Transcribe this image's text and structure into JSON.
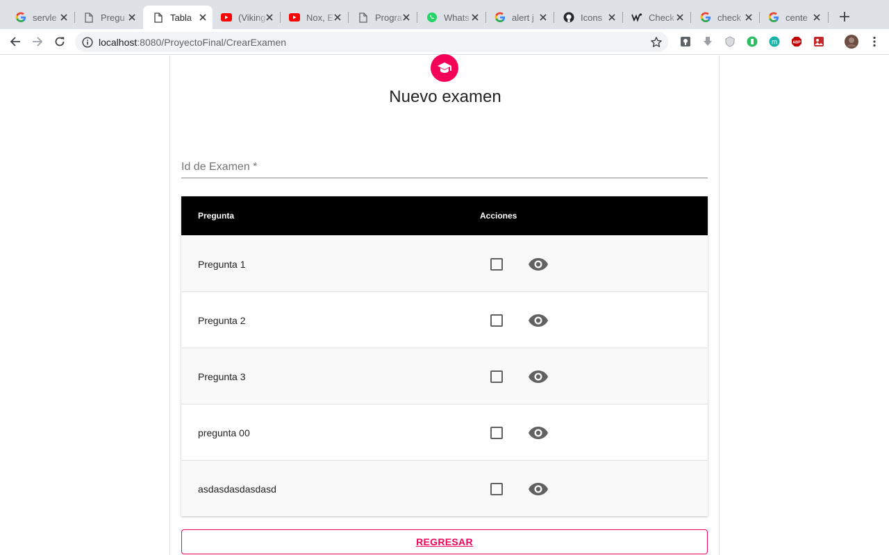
{
  "browser": {
    "tabs": [
      {
        "title": "servle",
        "icon": "google-icon"
      },
      {
        "title": "Pregu",
        "icon": "document-icon"
      },
      {
        "title": "Tabla",
        "icon": "document-icon",
        "active": true
      },
      {
        "title": "(Viking",
        "icon": "youtube-icon"
      },
      {
        "title": "Nox, E",
        "icon": "youtube-icon"
      },
      {
        "title": "Progra",
        "icon": "document-icon"
      },
      {
        "title": "Whats",
        "icon": "whatsapp-icon"
      },
      {
        "title": "alert j",
        "icon": "google-icon"
      },
      {
        "title": "Icons",
        "icon": "github-icon"
      },
      {
        "title": "Check",
        "icon": "site-icon"
      },
      {
        "title": "check",
        "icon": "google-icon"
      },
      {
        "title": "cente",
        "icon": "google-icon"
      }
    ],
    "url_host": "localhost",
    "url_path": ":8080/ProyectoFinal/CrearExamen"
  },
  "colors": {
    "accent": "#f50057",
    "header": "#000000"
  },
  "form": {
    "title": "Nuevo examen",
    "id_label": "Id de Examen *",
    "id_value": ""
  },
  "table": {
    "headers": [
      "Pregunta",
      "Acciones"
    ],
    "rows": [
      {
        "pregunta": "Pregunta 1",
        "checked": false
      },
      {
        "pregunta": "Pregunta 2",
        "checked": false
      },
      {
        "pregunta": "Pregunta 3",
        "checked": false
      },
      {
        "pregunta": "pregunta 00",
        "checked": false
      },
      {
        "pregunta": "asdasdasdasdasd",
        "checked": false
      }
    ]
  },
  "actions": {
    "back_label": "REGRESAR"
  }
}
